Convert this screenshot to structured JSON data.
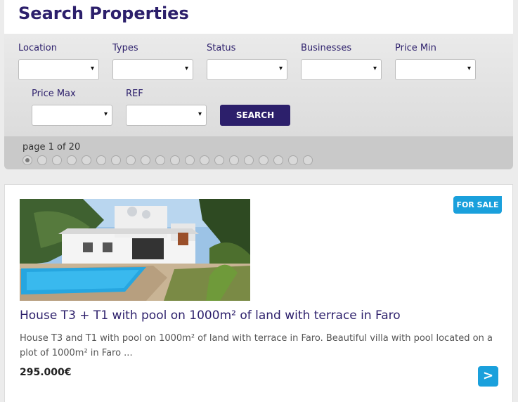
{
  "page": {
    "title": "Search Properties"
  },
  "filters": {
    "fields": [
      {
        "label": "Location",
        "value": ""
      },
      {
        "label": "Types",
        "value": ""
      },
      {
        "label": "Status",
        "value": ""
      },
      {
        "label": "Businesses",
        "value": ""
      },
      {
        "label": "Price Min",
        "value": ""
      },
      {
        "label": "Price Max",
        "value": ""
      },
      {
        "label": "REF",
        "value": ""
      }
    ],
    "search_label": "SEARCH",
    "dropdown_icon": "▾"
  },
  "pagination": {
    "info": "page 1 of 20",
    "total_pages": 20,
    "current_page": 1
  },
  "listing": {
    "badge": "FOR SALE",
    "title": "House T3 + T1 with pool on 1000m² of land with terrace in Faro",
    "description": "House T3 and T1 with pool on 1000m² of land with terrace in Faro. Beautiful villa with pool located on a plot of 1000m² in Faro ...",
    "price": "295.000€",
    "more_icon": ">",
    "image_icon": "house-photo"
  },
  "colors": {
    "brand": "#2c1f6b",
    "accent": "#1aa0dc"
  }
}
